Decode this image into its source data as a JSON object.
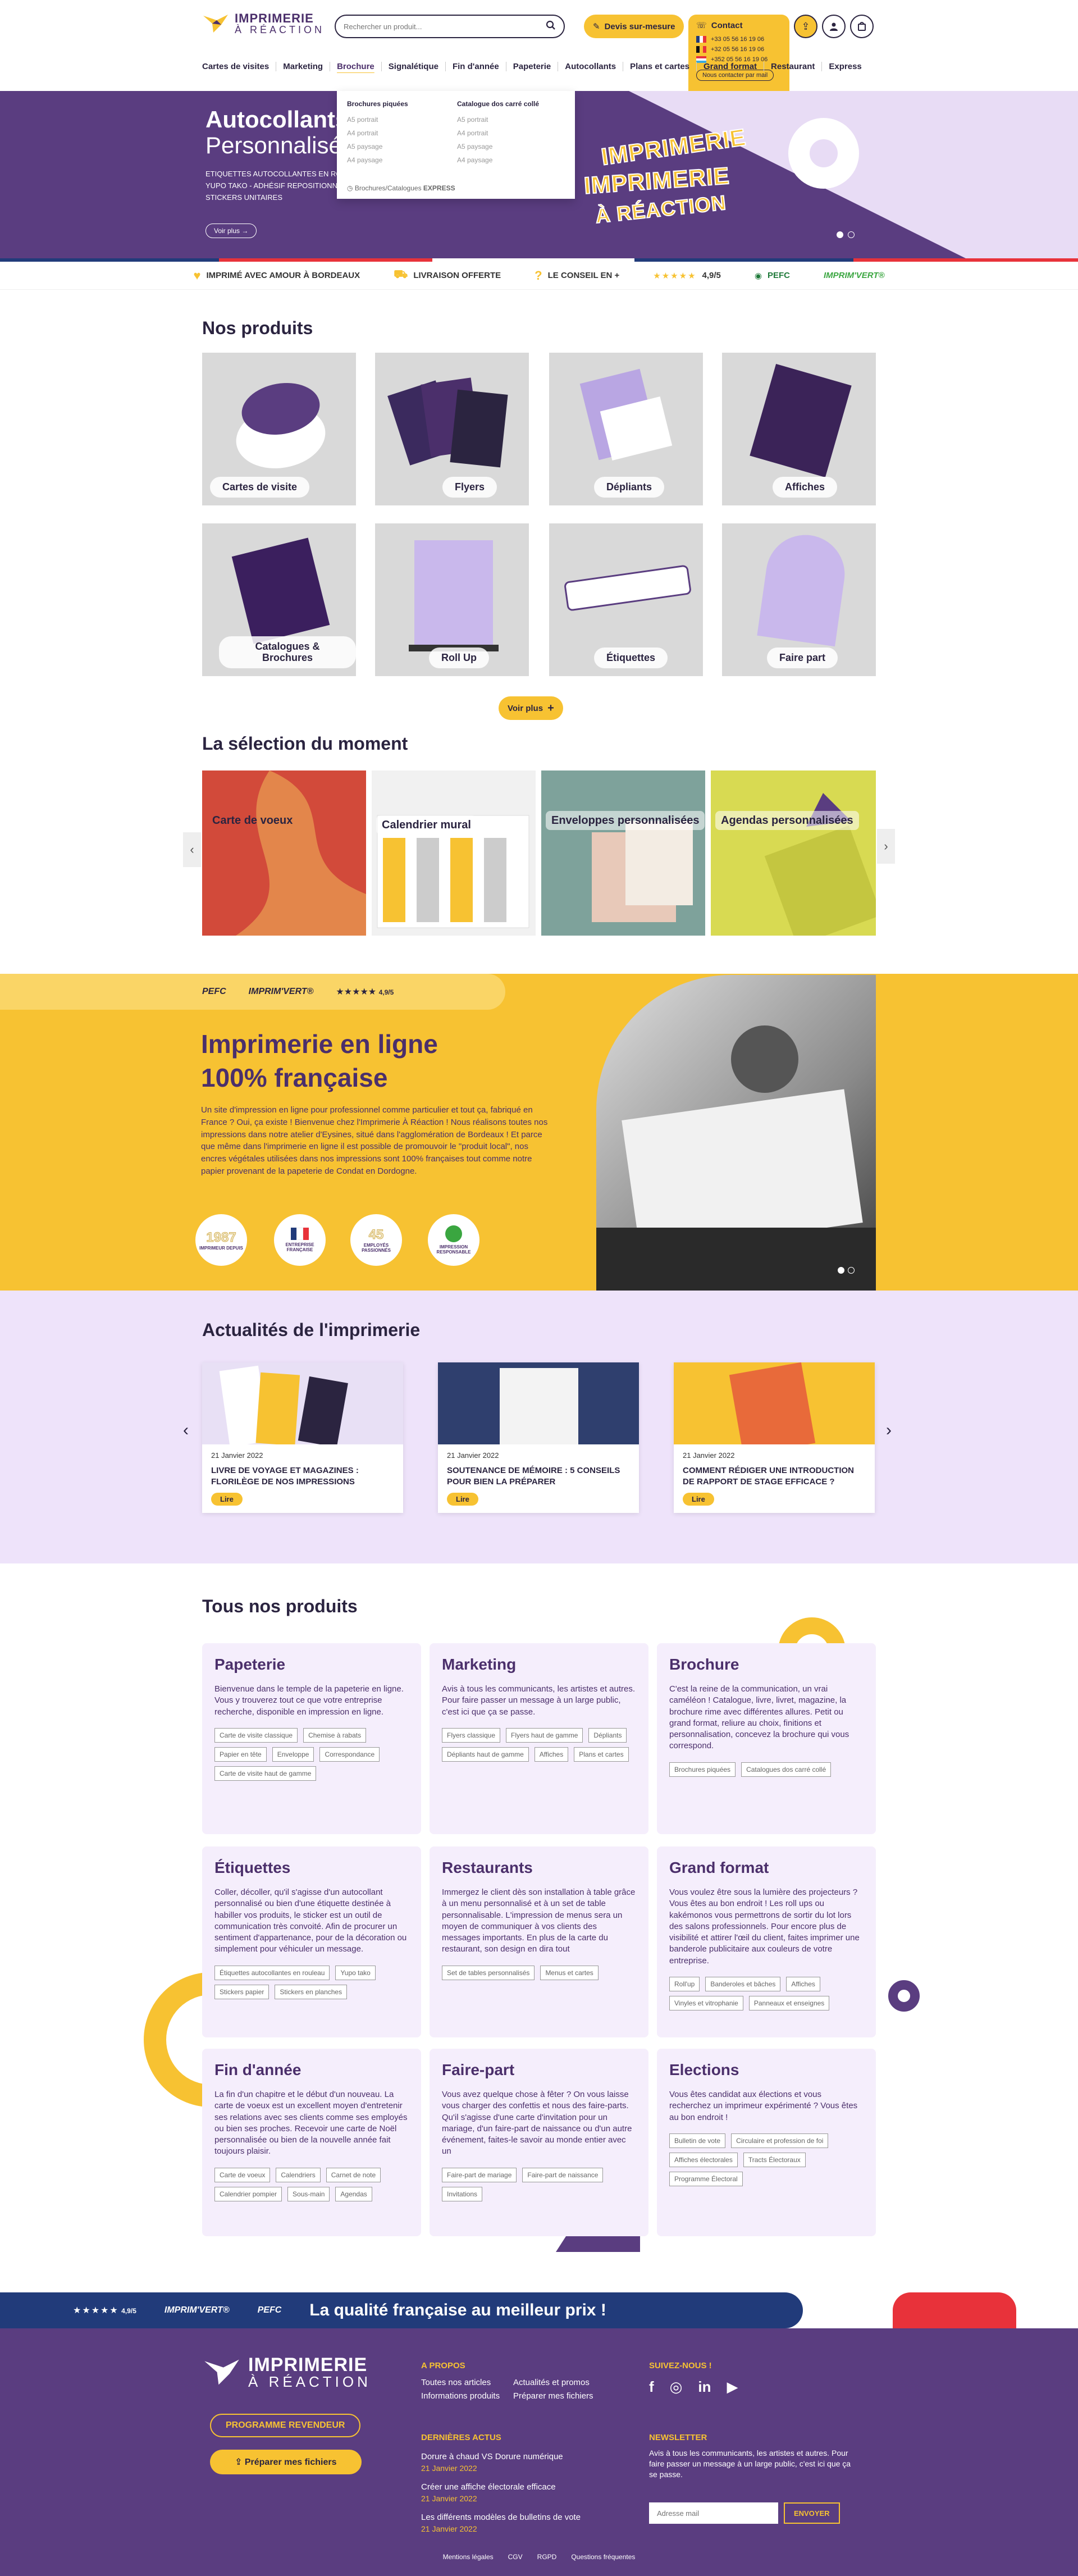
{
  "header": {
    "logo_line1": "IMPRIMERIE",
    "logo_line2": "À RÉACTION",
    "search_placeholder": "Rechercher un produit...",
    "devis_label": "Devis sur-mesure",
    "contact_label": "Contact",
    "phones": [
      "+33 05 56 16 19 06",
      "+32 05 56 16 19 06",
      "+352 05 56 16 19 06"
    ],
    "mail_label": "Nous contacter par mail",
    "nav": [
      "Cartes de visites",
      "Marketing",
      "Brochure",
      "Signalétique",
      "Fin d'année",
      "Papeterie",
      "Autocollants",
      "Plans et cartes",
      "Grand format",
      "Restaurant",
      "Express"
    ],
    "nav_active": "Brochure"
  },
  "mega_menu": {
    "col1_title": "Brochures piquées",
    "col1_items": [
      "A5 portrait",
      "A4 portrait",
      "A5 paysage",
      "A4 paysage"
    ],
    "col2_title": "Catalogue dos carré collé",
    "col2_items": [
      "A5 portrait",
      "A4 portrait",
      "A5 paysage",
      "A4 paysage"
    ],
    "footer_prefix": "Brochures/Catalogues",
    "footer_bold": "EXPRESS"
  },
  "hero": {
    "title": "Autocollants",
    "subtitle": "Personnalisés",
    "lines": [
      "ETIQUETTES AUTOCOLLANTES EN ROULEAU",
      "YUPO TAKO - ADHÉSIF REPOSITIONNABLE",
      "STICKERS UNITAIRES"
    ],
    "button": "Voir plus",
    "sticker_words": [
      "IMPRIMERIE",
      "IMPRIMERIE",
      "À RÉACTION"
    ]
  },
  "trust": {
    "items": [
      "IMPRIMÉ AVEC AMOUR À BORDEAUX",
      "LIVRAISON OFFERTE",
      "LE CONSEIL EN +"
    ],
    "rating": "4,9/5",
    "stars": "★★★★★",
    "pefc": "PEFC",
    "imprimvert": "IMPRIM'VERT®"
  },
  "products": {
    "title": "Nos produits",
    "items": [
      "Cartes de visite",
      "Flyers",
      "Dépliants",
      "Affiches",
      "Catalogues & Brochures",
      "Roll Up",
      "Étiquettes",
      "Faire part"
    ],
    "see_more": "Voir plus"
  },
  "selection": {
    "title": "La sélection du moment",
    "items": [
      "Carte de voeux",
      "Calendrier mural",
      "Enveloppes personnalisées",
      "Agendas personnalisées"
    ]
  },
  "about": {
    "pefc": "PEFC",
    "imprimvert": "IMPRIM'VERT®",
    "rating": "4,9/5",
    "stars": "★★★★★",
    "title_line1": "Imprimerie en ligne",
    "title_line2": "100% française",
    "text": "Un site d'impression en ligne pour professionnel comme particulier et tout ça, fabriqué en France ? Oui, ça existe ! Bienvenue chez l'Imprimerie À Réaction ! Nous réalisons toutes nos impressions dans notre atelier d'Eysines, situé dans l'agglomération de Bordeaux ! Et parce que même dans l'imprimerie en ligne il est possible de promouvoir le \"produit local\", nos encres végétales utilisées dans nos impressions sont 100% françaises tout comme notre papier provenant de la papeterie de Condat en Dordogne.",
    "badges": [
      {
        "big": "1987",
        "small": "IMPRIMEUR DEPUIS"
      },
      {
        "big": "",
        "small": "ENTREPRISE FRANÇAISE"
      },
      {
        "big": "45",
        "small": "EMPLOYÉS PASSIONNÉS"
      },
      {
        "big": "",
        "small": "IMPRESSION RESPONSABLE"
      }
    ]
  },
  "news": {
    "title": "Actualités de l'imprimerie",
    "cards": [
      {
        "date": "21 Janvier 2022",
        "title": "LIVRE DE VOYAGE ET MAGAZINES : FLORILÈGE DE NOS IMPRESSIONS",
        "read": "Lire"
      },
      {
        "date": "21 Janvier 2022",
        "title": "SOUTENANCE DE MÉMOIRE : 5 CONSEILS POUR BIEN LA PRÉPARER",
        "read": "Lire"
      },
      {
        "date": "21 Janvier 2022",
        "title": "COMMENT RÉDIGER UNE INTRODUCTION DE RAPPORT DE STAGE EFFICACE ?",
        "read": "Lire"
      }
    ]
  },
  "all_products": {
    "title": "Tous nos produits",
    "cats": [
      {
        "name": "Papeterie",
        "text": "Bienvenue dans le temple de la papeterie en ligne. Vous y trouverez tout ce que votre entreprise recherche, disponible en impression en ligne.",
        "tags": [
          "Carte de visite classique",
          "Chemise à rabats",
          "Papier en tête",
          "Enveloppe",
          "Correspondance",
          "Carte de visite haut de gamme"
        ]
      },
      {
        "name": "Marketing",
        "text": "Avis à tous les communicants, les artistes et autres. Pour faire passer un message à un large public, c'est ici que ça se passe.",
        "tags": [
          "Flyers classique",
          "Flyers haut de gamme",
          "Dépliants",
          "Dépliants haut de gamme",
          "Affiches",
          "Plans et cartes"
        ]
      },
      {
        "name": "Brochure",
        "text": "C'est la reine de la communication, un vrai caméléon ! Catalogue, livre, livret, magazine, la brochure rime avec différentes allures. Petit ou grand format, reliure au choix, finitions et personnalisation, concevez la brochure qui vous correspond.",
        "tags": [
          "Brochures piquées",
          "Catalogues dos carré collé"
        ]
      },
      {
        "name": "Étiquettes",
        "text": "Coller, décoller, qu'il s'agisse d'un autocollant personnalisé ou bien d'une étiquette destinée à habiller vos produits, le sticker est un outil de communication très convoité. Afin de procurer un sentiment d'appartenance, pour de la décoration ou simplement pour véhiculer un message.",
        "tags": [
          "Étiquettes autocollantes en rouleau",
          "Yupo tako",
          "Stickers papier",
          "Stickers en planches"
        ]
      },
      {
        "name": "Restaurants",
        "text": "Immergez le client dès son installation à table grâce à un menu personnalisé et à un set de table personnalisable. L'impression de menus sera un moyen de communiquer à vos clients des messages importants. En plus de la carte du restaurant, son design en dira tout",
        "tags": [
          "Set de tables personnalisés",
          "Menus et cartes"
        ]
      },
      {
        "name": "Grand format",
        "text": "Vous voulez être sous la lumière des projecteurs ? Vous êtes au bon endroit ! Les roll ups ou kakémonos vous permettrons de sortir du lot lors des salons professionnels. Pour encore plus de visibilité et attirer l'œil du client, faites imprimer une banderole publicitaire aux couleurs de votre entreprise.",
        "tags": [
          "Roll'up",
          "Banderoles et bâches",
          "Affiches",
          "Vinyles et vitrophanie",
          "Panneaux et enseignes"
        ]
      },
      {
        "name": "Fin d'année",
        "text": "La fin d'un chapitre et le début d'un nouveau. La carte de voeux est un excellent moyen d'entretenir ses relations avec ses clients comme ses employés ou bien ses proches. Recevoir une carte de Noël personnalisée ou bien de la nouvelle année fait toujours plaisir.",
        "tags": [
          "Carte de voeux",
          "Calendriers",
          "Carnet de note",
          "Calendrier pompier",
          "Sous-main",
          "Agendas"
        ]
      },
      {
        "name": "Faire-part",
        "text": "Vous avez quelque chose à fêter ? On vous laisse vous charger des confettis et nous des faire-parts. Qu'il s'agisse d'une carte d'invitation pour un mariage, d'un faire-part de naissance ou d'un autre événement, faites-le savoir au monde entier avec un",
        "tags": [
          "Faire-part de mariage",
          "Faire-part de naissance",
          "Invitations"
        ]
      },
      {
        "name": "Elections",
        "text": "Vous êtes candidat aux élections et vous recherchez un imprimeur expérimenté ? Vous êtes au bon endroit !",
        "tags": [
          "Bulletin de vote",
          "Circulaire et profession de foi",
          "Affiches électorales",
          "Tracts Électoraux",
          "Programme Électoral"
        ]
      }
    ]
  },
  "quality_banner": {
    "stars": "★★★★★",
    "rating": "4,9/5",
    "imprimvert": "IMPRIM'VERT®",
    "pefc": "PEFC",
    "headline": "La qualité française au meilleur prix !"
  },
  "footer": {
    "logo_line1": "IMPRIMERIE",
    "logo_line2": "À RÉACTION",
    "btn_revendeur": "PROGRAMME REVENDEUR",
    "btn_fichiers": "Préparer mes fichiers",
    "about_title": "A PROPOS",
    "about_links": [
      "Toutes nos articles",
      "Actualités et promos",
      "Informations produits",
      "Préparer mes fichiers"
    ],
    "news_title": "DERNIÈRES ACTUS",
    "news": [
      {
        "title": "Dorure à chaud VS Dorure numérique",
        "date": "21 Janvier 2022"
      },
      {
        "title": "Créer une affiche électorale efficace",
        "date": "21 Janvier 2022"
      },
      {
        "title": "Les différents modèles de bulletins de vote",
        "date": "21 Janvier 2022"
      }
    ],
    "follow_title": "SUIVEZ-NOUS !",
    "newsletter_title": "NEWSLETTER",
    "newsletter_text": "Avis à tous les communicants, les artistes et autres. Pour faire passer un message à un large public, c'est ici que ça se passe.",
    "newsletter_placeholder": "Adresse mail",
    "newsletter_btn": "ENVOYER",
    "legal": [
      "Mentions légales",
      "CGV",
      "RGPD",
      "Questions fréquentes"
    ]
  }
}
